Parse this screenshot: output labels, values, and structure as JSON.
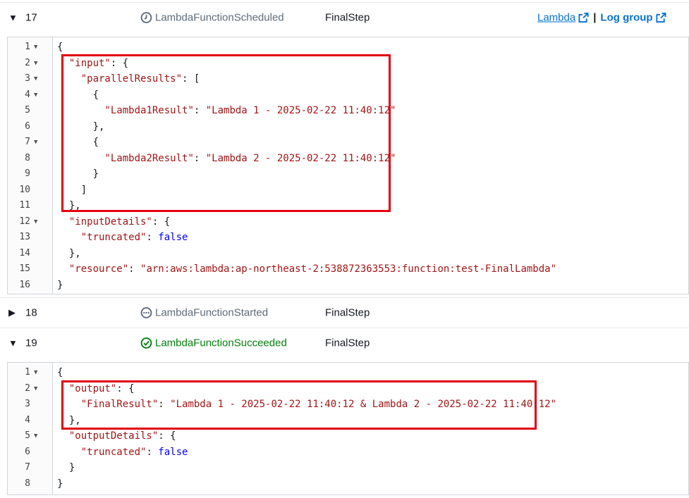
{
  "rows": [
    {
      "number": "17",
      "event": "LambdaFunctionScheduled",
      "step": "FinalStep"
    },
    {
      "number": "18",
      "event": "LambdaFunctionStarted",
      "step": "FinalStep"
    },
    {
      "number": "19",
      "event": "LambdaFunctionSucceeded",
      "step": "FinalStep"
    }
  ],
  "links": {
    "lambda": "Lambda",
    "separator": "|",
    "log_group": "Log group"
  },
  "code17": [
    {
      "n": "1",
      "fold": true,
      "text": "{"
    },
    {
      "n": "2",
      "fold": true,
      "text": "  \"input\": {"
    },
    {
      "n": "3",
      "fold": true,
      "text": "    \"parallelResults\": ["
    },
    {
      "n": "4",
      "fold": true,
      "text": "      {"
    },
    {
      "n": "5",
      "fold": false,
      "text": "        \"Lambda1Result\": \"Lambda 1 - 2025-02-22 11:40:12\""
    },
    {
      "n": "6",
      "fold": false,
      "text": "      },"
    },
    {
      "n": "7",
      "fold": true,
      "text": "      {"
    },
    {
      "n": "8",
      "fold": false,
      "text": "        \"Lambda2Result\": \"Lambda 2 - 2025-02-22 11:40:12\""
    },
    {
      "n": "9",
      "fold": false,
      "text": "      }"
    },
    {
      "n": "10",
      "fold": false,
      "text": "    ]"
    },
    {
      "n": "11",
      "fold": false,
      "text": "  },"
    },
    {
      "n": "12",
      "fold": true,
      "text": "  \"inputDetails\": {"
    },
    {
      "n": "13",
      "fold": false,
      "text": "    \"truncated\": false"
    },
    {
      "n": "14",
      "fold": false,
      "text": "  },"
    },
    {
      "n": "15",
      "fold": false,
      "text": "  \"resource\": \"arn:aws:lambda:ap-northeast-2:538872363553:function:test-FinalLambda\""
    },
    {
      "n": "16",
      "fold": false,
      "text": "}"
    }
  ],
  "code19": [
    {
      "n": "1",
      "fold": true,
      "text": "{"
    },
    {
      "n": "2",
      "fold": true,
      "text": "  \"output\": {"
    },
    {
      "n": "3",
      "fold": false,
      "text": "    \"FinalResult\": \"Lambda 1 - 2025-02-22 11:40:12 & Lambda 2 - 2025-02-22 11:40:12\""
    },
    {
      "n": "4",
      "fold": false,
      "text": "  },"
    },
    {
      "n": "5",
      "fold": true,
      "text": "  \"outputDetails\": {"
    },
    {
      "n": "6",
      "fold": false,
      "text": "    \"truncated\": false"
    },
    {
      "n": "7",
      "fold": false,
      "text": "  }"
    },
    {
      "n": "8",
      "fold": false,
      "text": "}"
    }
  ],
  "icons": {
    "row17": "clock-icon",
    "row18": "ellipsis-circle-icon",
    "row19": "check-circle-icon",
    "external": "external-link-icon"
  },
  "colors": {
    "highlight": "#e3000f",
    "success": "#037f0c",
    "link": "#0972d3"
  }
}
